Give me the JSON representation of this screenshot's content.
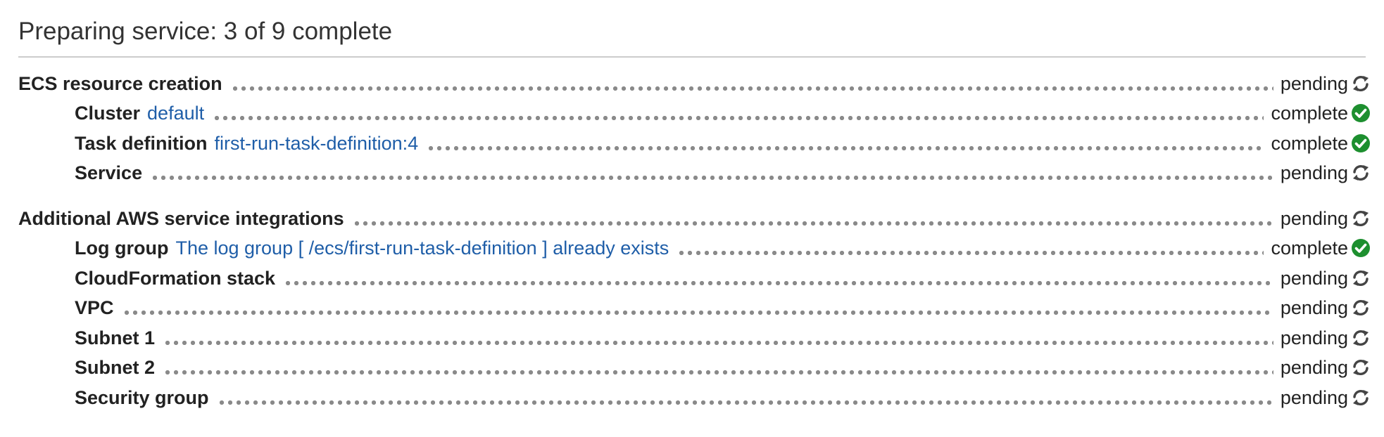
{
  "header": {
    "title": "Preparing service: 3 of 9 complete"
  },
  "colors": {
    "link": "#1f5ea8",
    "complete_icon": "#1d8f2f",
    "pending_icon": "#444444",
    "leader_dots": "#8a8a8a"
  },
  "sections": [
    {
      "label": "ECS resource creation",
      "status": "pending",
      "status_icon": "refresh-icon",
      "items": [
        {
          "label": "Cluster",
          "link": "default",
          "status": "complete",
          "status_icon": "check-circle-icon"
        },
        {
          "label": "Task definition",
          "link": "first-run-task-definition:4",
          "status": "complete",
          "status_icon": "check-circle-icon"
        },
        {
          "label": "Service",
          "link": "",
          "status": "pending",
          "status_icon": "refresh-icon"
        }
      ]
    },
    {
      "label": "Additional AWS service integrations",
      "status": "pending",
      "status_icon": "refresh-icon",
      "items": [
        {
          "label": "Log group",
          "link": "The log group [ /ecs/first-run-task-definition ] already exists",
          "status": "complete",
          "status_icon": "check-circle-icon"
        },
        {
          "label": "CloudFormation stack",
          "link": "",
          "status": "pending",
          "status_icon": "refresh-icon"
        },
        {
          "label": "VPC",
          "link": "",
          "status": "pending",
          "status_icon": "refresh-icon"
        },
        {
          "label": "Subnet 1",
          "link": "",
          "status": "pending",
          "status_icon": "refresh-icon"
        },
        {
          "label": "Subnet 2",
          "link": "",
          "status": "pending",
          "status_icon": "refresh-icon"
        },
        {
          "label": "Security group",
          "link": "",
          "status": "pending",
          "status_icon": "refresh-icon"
        }
      ]
    }
  ]
}
